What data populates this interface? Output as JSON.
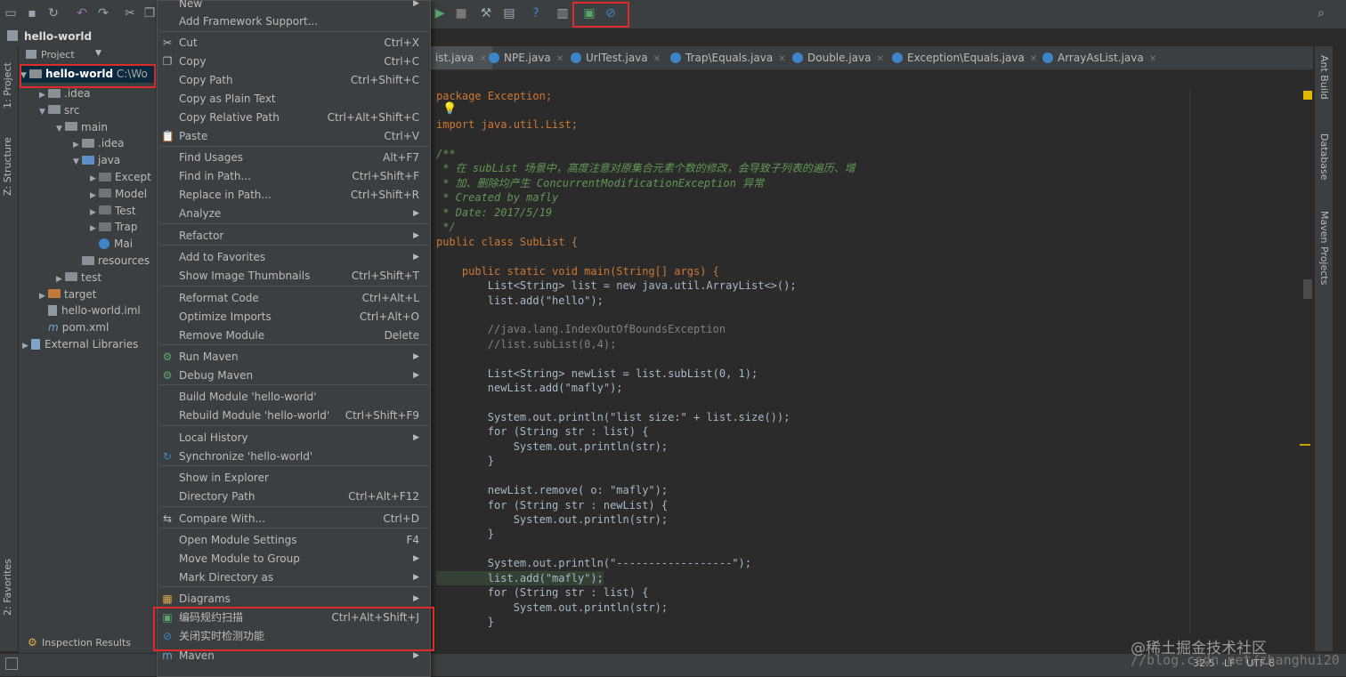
{
  "project": {
    "name": "hello-world",
    "view_label": "Project",
    "root_label": "hello-world",
    "root_path": "C:\\Wo",
    "tree": [
      {
        "label": ".idea",
        "indent": 1,
        "type": "folder"
      },
      {
        "label": "src",
        "indent": 1,
        "type": "folder"
      },
      {
        "label": "main",
        "indent": 2,
        "type": "folder"
      },
      {
        "label": ".idea",
        "indent": 3,
        "type": "folder"
      },
      {
        "label": "java",
        "indent": 3,
        "type": "folder-blue"
      },
      {
        "label": "Except",
        "indent": 4,
        "type": "folder-dark"
      },
      {
        "label": "Model",
        "indent": 4,
        "type": "folder-dark"
      },
      {
        "label": "Test",
        "indent": 4,
        "type": "folder-dark"
      },
      {
        "label": "Trap",
        "indent": 4,
        "type": "folder-dark"
      },
      {
        "label": "Mai",
        "indent": 4,
        "type": "class"
      },
      {
        "label": "resources",
        "indent": 3,
        "type": "folder"
      },
      {
        "label": "test",
        "indent": 2,
        "type": "folder"
      },
      {
        "label": "target",
        "indent": 1,
        "type": "folder-orange"
      },
      {
        "label": "hello-world.iml",
        "indent": 1,
        "type": "file"
      },
      {
        "label": "pom.xml",
        "indent": 1,
        "type": "maven"
      },
      {
        "label": "External Libraries",
        "indent": 0,
        "type": "lib"
      }
    ]
  },
  "left_tabs": {
    "project": "1: Project",
    "structure": "Z: Structure",
    "favorites": "2: Favorites"
  },
  "right_tabs": {
    "ant": "Ant Build",
    "database": "Database",
    "maven": "Maven Projects"
  },
  "bottom": {
    "inspection": "Inspection Results"
  },
  "status": {
    "position": "32:5",
    "line_sep": "LF",
    "encoding": "UTF-8"
  },
  "tabs": [
    {
      "label": "ist.java"
    },
    {
      "label": "NPE.java"
    },
    {
      "label": "UrlTest.java"
    },
    {
      "label": "Trap\\Equals.java"
    },
    {
      "label": "Double.java"
    },
    {
      "label": "Exception\\Equals.java"
    },
    {
      "label": "ArrayAsList.java"
    }
  ],
  "menu": {
    "items": [
      {
        "label": "New",
        "shortcut": "",
        "submenu": true
      },
      {
        "label": "Add Framework Support...",
        "shortcut": ""
      },
      {
        "label": "Cut",
        "shortcut": "Ctrl+X",
        "icon": "✂"
      },
      {
        "label": "Copy",
        "shortcut": "Ctrl+C",
        "icon": "❐"
      },
      {
        "label": "Copy Path",
        "shortcut": "Ctrl+Shift+C"
      },
      {
        "label": "Copy as Plain Text",
        "shortcut": ""
      },
      {
        "label": "Copy Relative Path",
        "shortcut": "Ctrl+Alt+Shift+C"
      },
      {
        "label": "Paste",
        "shortcut": "Ctrl+V",
        "icon": "📋"
      },
      {
        "label": "Find Usages",
        "shortcut": "Alt+F7"
      },
      {
        "label": "Find in Path...",
        "shortcut": "Ctrl+Shift+F"
      },
      {
        "label": "Replace in Path...",
        "shortcut": "Ctrl+Shift+R"
      },
      {
        "label": "Analyze",
        "shortcut": "",
        "submenu": true
      },
      {
        "label": "Refactor",
        "shortcut": "",
        "submenu": true
      },
      {
        "label": "Add to Favorites",
        "shortcut": "",
        "submenu": true
      },
      {
        "label": "Show Image Thumbnails",
        "shortcut": "Ctrl+Shift+T"
      },
      {
        "label": "Reformat Code",
        "shortcut": "Ctrl+Alt+L"
      },
      {
        "label": "Optimize Imports",
        "shortcut": "Ctrl+Alt+O"
      },
      {
        "label": "Remove Module",
        "shortcut": "Delete"
      },
      {
        "label": "Run Maven",
        "shortcut": "",
        "submenu": true,
        "icon": "⚙"
      },
      {
        "label": "Debug Maven",
        "shortcut": "",
        "submenu": true,
        "icon": "⚙"
      },
      {
        "label": "Build Module 'hello-world'",
        "shortcut": ""
      },
      {
        "label": "Rebuild Module 'hello-world'",
        "shortcut": "Ctrl+Shift+F9"
      },
      {
        "label": "Local History",
        "shortcut": "",
        "submenu": true
      },
      {
        "label": "Synchronize 'hello-world'",
        "shortcut": "",
        "icon": "↻"
      },
      {
        "label": "Show in Explorer",
        "shortcut": ""
      },
      {
        "label": "Directory Path",
        "shortcut": "Ctrl+Alt+F12"
      },
      {
        "label": "Compare With...",
        "shortcut": "Ctrl+D",
        "icon": "⇆"
      },
      {
        "label": "Open Module Settings",
        "shortcut": "F4"
      },
      {
        "label": "Move Module to Group",
        "shortcut": "",
        "submenu": true
      },
      {
        "label": "Mark Directory as",
        "shortcut": "",
        "submenu": true
      },
      {
        "label": "Diagrams",
        "shortcut": "",
        "submenu": true,
        "icon": "▦"
      },
      {
        "label": "编码规约扫描",
        "shortcut": "Ctrl+Alt+Shift+J",
        "icon": "▣"
      },
      {
        "label": "关闭实时检测功能",
        "shortcut": "",
        "icon": "⊘"
      },
      {
        "label": "Maven",
        "shortcut": "",
        "submenu": true,
        "icon": "m"
      }
    ]
  },
  "code": [
    "package Exception;",
    "",
    "import java.util.List;",
    "",
    "/**",
    " * 在 subList 场景中，高度注意对原集合元素个数的修改，会导致子列表的遍历、增",
    " * 加、删除均产生 ConcurrentModificationException 异常",
    " * Created by mafly",
    " * Date: 2017/5/19",
    " */",
    "public class SubList {",
    "",
    "    public static void main(String[] args) {",
    "        List<String> list = new java.util.ArrayList<>();",
    "        list.add(\"hello\");",
    "",
    "        //java.lang.IndexOutOfBoundsException",
    "        //list.subList(0,4);",
    "",
    "        List<String> newList = list.subList(0, 1);",
    "        newList.add(\"mafly\");",
    "",
    "        System.out.println(\"list size:\" + list.size());",
    "        for (String str : list) {",
    "            System.out.println(str);",
    "        }",
    "",
    "        newList.remove( o: \"mafly\");",
    "        for (String str : newList) {",
    "            System.out.println(str);",
    "        }",
    "",
    "        System.out.println(\"------------------\");",
    "        list.add(\"mafly\");",
    "        for (String str : list) {",
    "            System.out.println(str);",
    "        }"
  ],
  "watermark": {
    "line1": "@稀土掘金技术社区",
    "line2": "//blog.csdn.net/zhanghui20"
  },
  "colors": {
    "highlight_box": "#e02a2a",
    "menu_bg": "#3c3f41",
    "editor_bg": "#2b2b2b"
  }
}
